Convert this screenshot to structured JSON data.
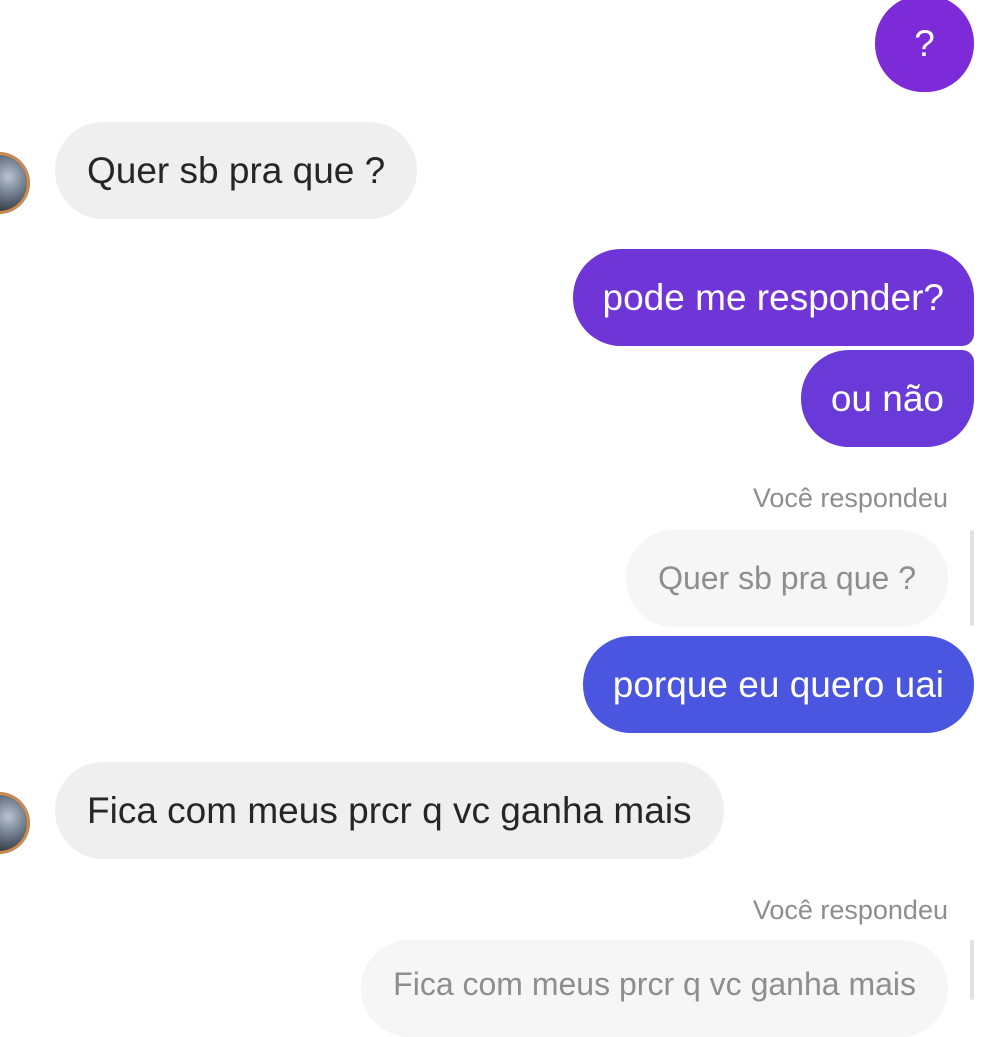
{
  "messages": {
    "m1": {
      "text": "?",
      "color": "#7d2ad8"
    },
    "m2": {
      "text": "Quer sb pra que ?"
    },
    "m3": {
      "text": "pode me responder?",
      "color": "#6f35d6"
    },
    "m4": {
      "text": "ou não",
      "color": "#6a3ad8"
    },
    "reply1": {
      "label": "Você respondeu",
      "quoted": "Quer sb pra que ?",
      "text": "porque eu quero uai",
      "color": "#4a56e0"
    },
    "m5": {
      "text": "Fica com meus prcr q vc ganha mais"
    },
    "reply2": {
      "label": "Você respondeu",
      "quoted": "Fica com meus prcr q vc ganha mais"
    }
  }
}
